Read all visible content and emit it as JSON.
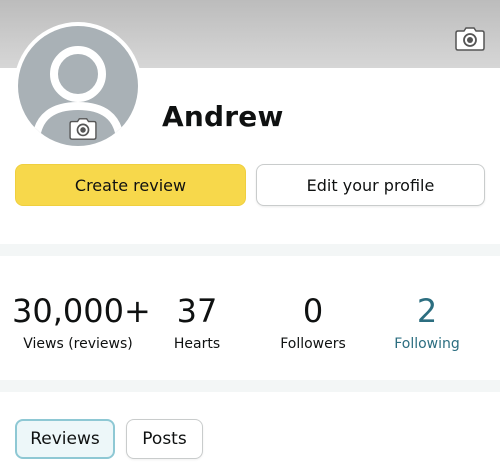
{
  "profile": {
    "name": "Andrew"
  },
  "icons": {
    "cover_camera": "camera-icon",
    "avatar_camera": "camera-icon",
    "avatar": "person-silhouette-icon"
  },
  "actions": {
    "create_review": "Create review",
    "edit_profile": "Edit your profile"
  },
  "stats": [
    {
      "value": "30,000+",
      "label": "Views (reviews)"
    },
    {
      "value": "37",
      "label": "Hearts"
    },
    {
      "value": "0",
      "label": "Followers"
    },
    {
      "value": "2",
      "label": "Following"
    }
  ],
  "tabs": [
    {
      "label": "Reviews",
      "active": true
    },
    {
      "label": "Posts",
      "active": false
    }
  ],
  "colors": {
    "primary_button": "#f7d84b",
    "link_accent": "#2c6e80",
    "active_tab_border": "#8ec8d4",
    "avatar_bg": "#a9b1b6"
  }
}
